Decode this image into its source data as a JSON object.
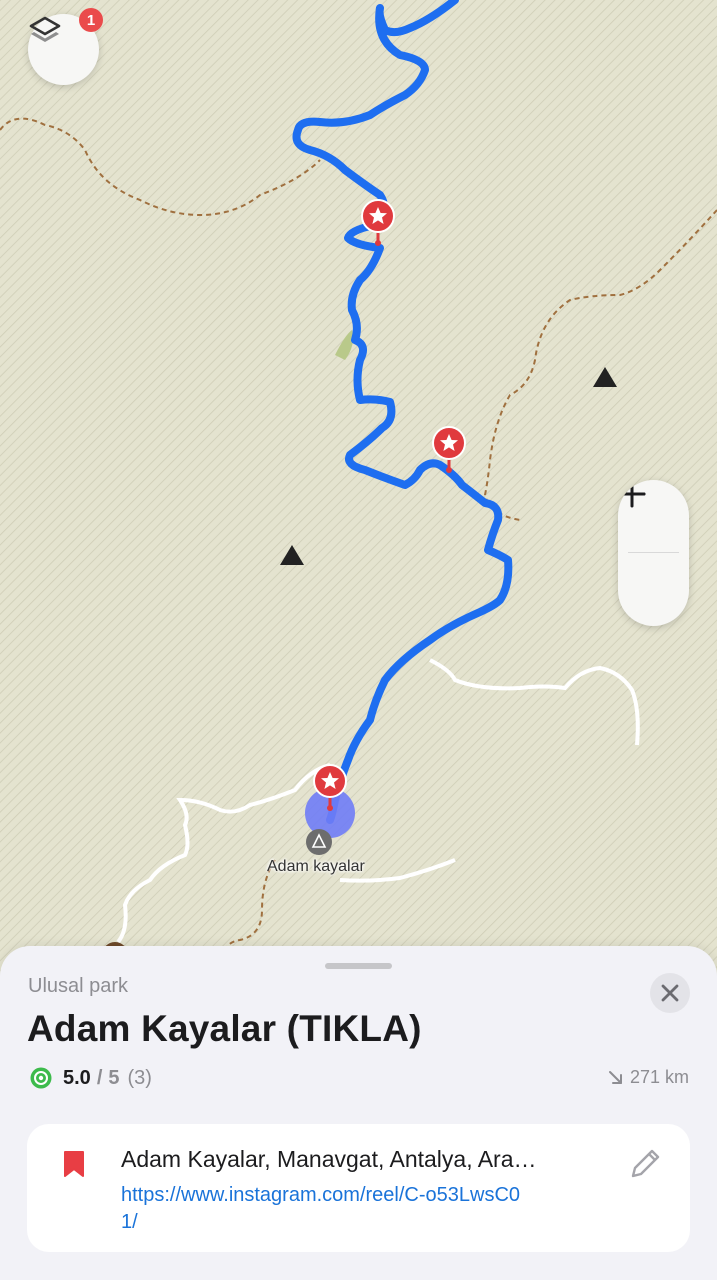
{
  "map": {
    "layers_button_icon": "layers-icon",
    "layers_badge_count": "1",
    "zoom_in_label": "+",
    "zoom_out_label": "−",
    "place_label": "Adam kayalar",
    "route_color": "#1e6ef0",
    "pin_color": "#e03a3e"
  },
  "sheet": {
    "category": "Ulusal park",
    "title": "Adam Kayalar (TIKLA)",
    "rating": {
      "value": "5.0",
      "slash": "/",
      "max": "5",
      "count": "(3)",
      "icon": "rating-badge-icon"
    },
    "distance": "271 km",
    "distance_icon": "arrow-down-right-icon",
    "close_icon": "close-icon",
    "card": {
      "icon": "bookmark-icon",
      "address": "Adam Kayalar, Manavgat, Antalya, Ara…",
      "link": "https://www.instagram.com/reel/C-o53LwsC01/",
      "edit_icon": "pencil-icon"
    }
  }
}
